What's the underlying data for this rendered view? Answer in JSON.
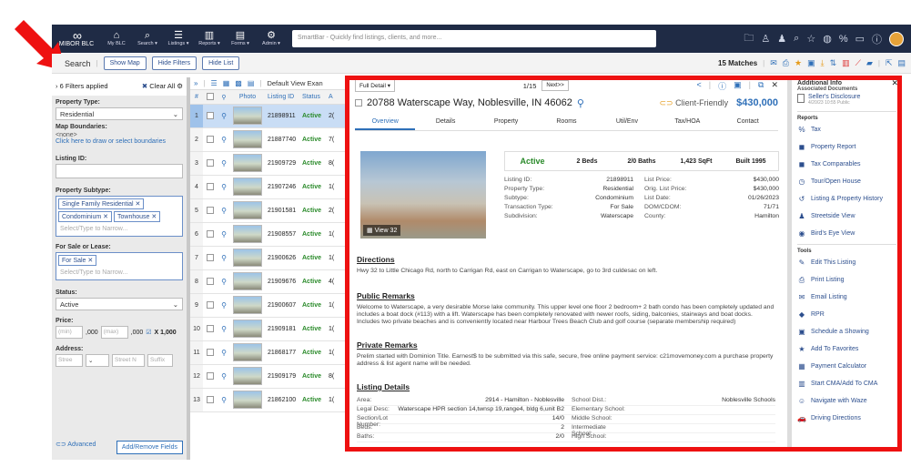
{
  "nav": {
    "logo": "MIBOR BLC",
    "items": [
      {
        "label": "My BLC",
        "icon": "home-icon",
        "glyph": "⌂"
      },
      {
        "label": "Search ▾",
        "icon": "search-icon",
        "glyph": "⌕"
      },
      {
        "label": "Listings ▾",
        "icon": "list-icon",
        "glyph": "☰"
      },
      {
        "label": "Reports ▾",
        "icon": "bar-chart-icon",
        "glyph": "▥"
      },
      {
        "label": "Forms ▾",
        "icon": "document-icon",
        "glyph": "▤"
      },
      {
        "label": "Admin ▾",
        "icon": "admin-icon",
        "glyph": "⚙"
      }
    ],
    "smartbar_placeholder": "SmartBar - Quickly find listings, clients, and more..."
  },
  "toolbar": {
    "title": "Search",
    "show_map": "Show Map",
    "hide_filters": "Hide Filters",
    "hide_list": "Hide List",
    "matches": "15 Matches"
  },
  "filters": {
    "applied": "6 Filters applied",
    "clear_all": "Clear All",
    "property_type_label": "Property Type:",
    "property_type_value": "Residential",
    "map_boundaries_label": "Map Boundaries:",
    "map_boundaries_value": "<none>",
    "map_boundaries_link": "Click here to draw or select boundaries",
    "listing_id_label": "Listing ID:",
    "subtype_label": "Property Subtype:",
    "subtype_chips": [
      "Single Family Residential ✕",
      "Condominium ✕",
      "Townhouse ✕"
    ],
    "subtype_placeholder": "Select/Type to Narrow...",
    "sale_lease_label": "For Sale or Lease:",
    "sale_lease_chips": [
      "For Sale ✕"
    ],
    "sale_lease_placeholder": "Select/Type to Narrow...",
    "status_label": "Status:",
    "status_value": "Active",
    "price_label": "Price:",
    "price_min": "(min)",
    "price_max": "(max)",
    "price_suffix": ",000",
    "price_mult": "X 1,000",
    "address_label": "Address:",
    "address_street": "Stree",
    "address_streetn": "Street N",
    "address_suffix": "Suffix",
    "advanced": "Advanced",
    "add_remove": "Add/Remove Fields"
  },
  "grid": {
    "view_label": "Default View Exan",
    "headers": [
      "#",
      "Photo",
      "Listing ID",
      "Status",
      "A"
    ],
    "rows": [
      {
        "n": "1",
        "id": "21898911",
        "status": "Active",
        "a": "2("
      },
      {
        "n": "2",
        "id": "21887740",
        "status": "Active",
        "a": "7("
      },
      {
        "n": "3",
        "id": "21909729",
        "status": "Active",
        "a": "8("
      },
      {
        "n": "4",
        "id": "21907246",
        "status": "Active",
        "a": "1("
      },
      {
        "n": "5",
        "id": "21901581",
        "status": "Active",
        "a": "2("
      },
      {
        "n": "6",
        "id": "21908557",
        "status": "Active",
        "a": "1("
      },
      {
        "n": "7",
        "id": "21900626",
        "status": "Active",
        "a": "1("
      },
      {
        "n": "8",
        "id": "21909676",
        "status": "Active",
        "a": "4("
      },
      {
        "n": "9",
        "id": "21900607",
        "status": "Active",
        "a": "1("
      },
      {
        "n": "10",
        "id": "21909181",
        "status": "Active",
        "a": "1("
      },
      {
        "n": "11",
        "id": "21868177",
        "status": "Active",
        "a": "1("
      },
      {
        "n": "12",
        "id": "21909179",
        "status": "Active",
        "a": "8("
      },
      {
        "n": "13",
        "id": "21862100",
        "status": "Active",
        "a": "1("
      }
    ]
  },
  "detail": {
    "view_select": "Full Detail ▾",
    "counter": "1/15",
    "next": "Next>>",
    "address": "20788 Waterscape Way, Noblesville, IN 46062",
    "client_friendly": "Client-Friendly",
    "price": "$430,000",
    "tabs": [
      "Overview",
      "Details",
      "Property",
      "Rooms",
      "Util/Env",
      "Tax/HOA",
      "Contact"
    ],
    "photo_label": "View 32",
    "summary": [
      "Active",
      "2 Beds",
      "2/0 Baths",
      "1,423 SqFt",
      "Built 1995"
    ],
    "facts": [
      [
        "Listing ID:",
        "21898911",
        "List Price:",
        "$430,000"
      ],
      [
        "Property Type:",
        "Residential",
        "Orig. List Price:",
        "$430,000"
      ],
      [
        "Subtype:",
        "Condominium",
        "List Date:",
        "01/26/2023"
      ],
      [
        "Transaction Type:",
        "For Sale",
        "DOM/CDOM:",
        "71/71"
      ],
      [
        "Subdivision:",
        "Waterscape",
        "County:",
        "Hamilton"
      ]
    ],
    "directions_h": "Directions",
    "directions": "Hwy 32 to Little Chicago Rd, north to Carrigan Rd, east on Carrigan to Waterscape, go to 3rd culdesac on left.",
    "public_h": "Public Remarks",
    "public": "Welcome to Waterscape, a very desirable Morse lake community. This upper level one floor 2 bedroom+ 2 bath condo has been completely updated and includes a boat dock (#113) with a lift. Waterscape has been completely renovated with newer roofs, siding, balconies, stairways and boat docks. Includes two private beaches and is conveniently located near Harbour Trees Beach Club and golf course (separate membership required)",
    "private_h": "Private Remarks",
    "private": "Prelim started with Dominion Title. Earnest$ to be submitted via this safe, secure, free online payment service: c21movemoney.com a purchase property address & list agent name will be needed.",
    "listing_details_h": "Listing Details",
    "listing_details": [
      [
        "Area:",
        "2914 - Hamilton - Noblesville",
        "School Dist.:",
        "Noblesville Schools"
      ],
      [
        "Legal Desc:",
        "Waterscape HPR section 14,twnsp 19,range4, bldg 6,unit B2",
        "Elementary School:",
        ""
      ],
      [
        "Section/Lot Number:",
        "14/0",
        "Middle School:",
        ""
      ],
      [
        "Beds:",
        "2",
        "Intermediate School:",
        ""
      ],
      [
        "Baths:",
        "2/0",
        "High School:",
        ""
      ]
    ]
  },
  "rightpanel": {
    "title": "Additional Info",
    "docs_h": "Associated Documents",
    "doc_name": "Seller's Disclosure",
    "doc_sub": "4/20/23 10:55 Public",
    "reports_h": "Reports",
    "reports": [
      {
        "label": "Tax",
        "icon": "tax-icon",
        "glyph": "%"
      },
      {
        "label": "Property Report",
        "icon": "property-report-icon",
        "glyph": "◼"
      },
      {
        "label": "Tax Comparables",
        "icon": "tax-comparables-icon",
        "glyph": "◼"
      },
      {
        "label": "Tour/Open House",
        "icon": "clock-icon",
        "glyph": "◷"
      },
      {
        "label": "Listing & Property History",
        "icon": "history-icon",
        "glyph": "↺"
      },
      {
        "label": "Streetside View",
        "icon": "streetside-icon",
        "glyph": "♟"
      },
      {
        "label": "Bird's Eye View",
        "icon": "birds-eye-icon",
        "glyph": "◉"
      }
    ],
    "tools_h": "Tools",
    "tools": [
      {
        "label": "Edit This Listing",
        "icon": "pencil-icon",
        "glyph": "✎"
      },
      {
        "label": "Print Listing",
        "icon": "printer-icon",
        "glyph": "⎙"
      },
      {
        "label": "Email Listing",
        "icon": "email-icon",
        "glyph": "✉"
      },
      {
        "label": "RPR",
        "icon": "rpr-icon",
        "glyph": "◆"
      },
      {
        "label": "Schedule a Showing",
        "icon": "calendar-icon",
        "glyph": "▣"
      },
      {
        "label": "Add To Favorites",
        "icon": "star-icon",
        "glyph": "★"
      },
      {
        "label": "Payment Calculator",
        "icon": "calculator-icon",
        "glyph": "▦"
      },
      {
        "label": "Start CMA/Add To CMA",
        "icon": "cma-chart-icon",
        "glyph": "▥"
      },
      {
        "label": "Navigate with Waze",
        "icon": "waze-icon",
        "glyph": "☺"
      },
      {
        "label": "Driving Directions",
        "icon": "car-icon",
        "glyph": "🚗"
      }
    ]
  },
  "colors": {
    "accent": "#2e6fb8",
    "nav": "#1f2b45",
    "active": "#2a8a2a",
    "highlight": "#ee1111"
  }
}
